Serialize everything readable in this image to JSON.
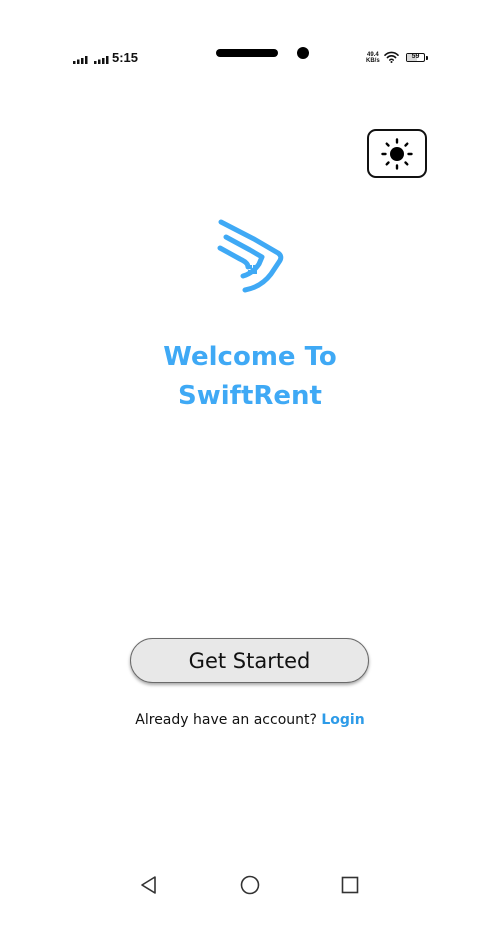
{
  "status_bar": {
    "time": "5:15",
    "net_speed_value": "49.4",
    "net_speed_unit": "KB/s",
    "battery_level": "59",
    "icons": [
      "signal-icon",
      "signal-icon",
      "wifi-icon",
      "battery-icon"
    ]
  },
  "theme_toggle": {
    "icon": "sun-icon"
  },
  "welcome": {
    "line1": "Welcome To",
    "line2": "SwiftRent"
  },
  "actions": {
    "get_started_label": "Get Started",
    "account_prompt": "Already have an account?",
    "login_label": "Login"
  },
  "navigation": {
    "icons": [
      "back-icon",
      "home-icon",
      "recents-icon"
    ]
  },
  "colors": {
    "brand": "#3fa9f5",
    "link": "#2d9be8",
    "button_bg": "#e8e8e8",
    "text": "#111111",
    "background": "#ffffff"
  }
}
